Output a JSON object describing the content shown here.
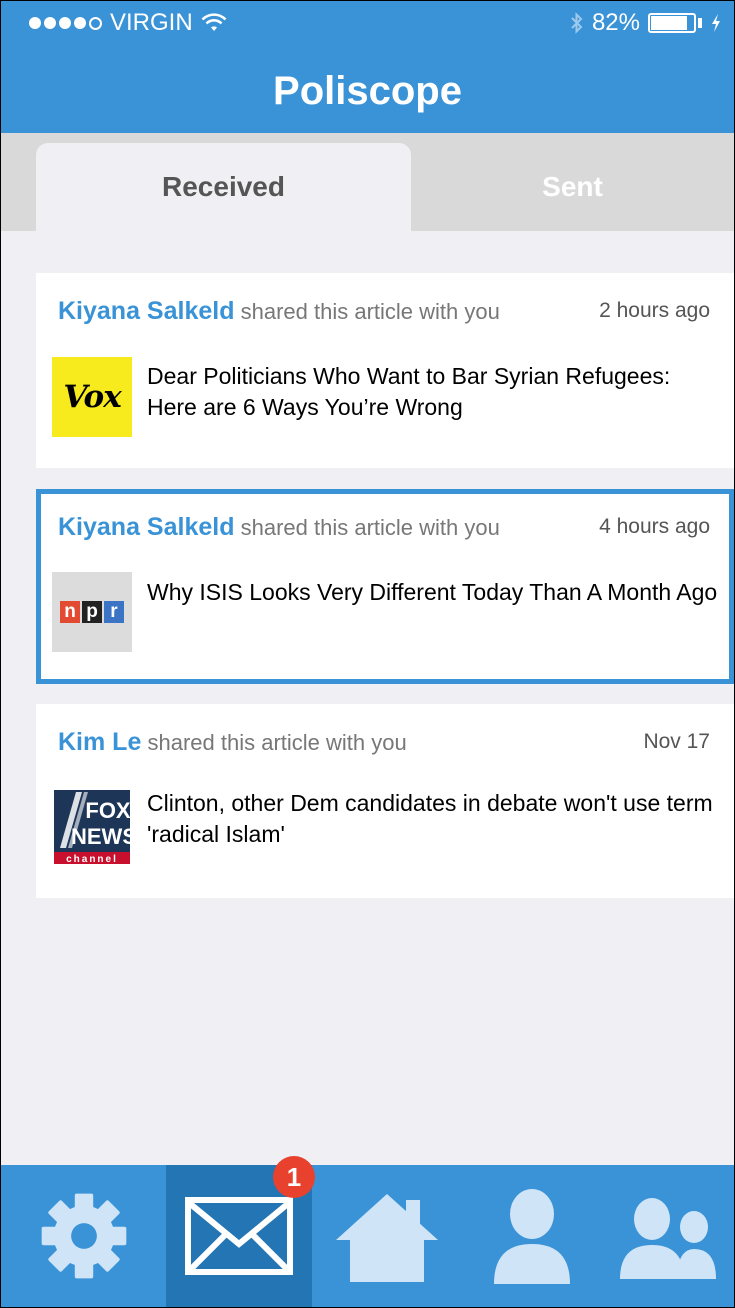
{
  "status_bar": {
    "carrier": "VIRGIN",
    "battery": "82%",
    "signal_dots_filled": 4,
    "signal_dots_total": 5
  },
  "header": {
    "title": "Poliscope"
  },
  "tabs": [
    {
      "label": "Received",
      "active": true
    },
    {
      "label": "Sent",
      "active": false
    }
  ],
  "feed": [
    {
      "sender": "Kiyana Salkeld",
      "action": "shared this article with you",
      "time": "2 hours ago",
      "source": "Vox",
      "logo_text": "Vox",
      "headline": "Dear Politicians Who Want to Bar Syrian Refugees: Here are 6 Ways You’re Wrong",
      "selected": false
    },
    {
      "sender": "Kiyana Salkeld",
      "action": "shared this article with you",
      "time": "4 hours ago",
      "source": "NPR",
      "logo_letters": [
        "n",
        "p",
        "r"
      ],
      "headline": "Why ISIS Looks Very Different Today Than A Month Ago",
      "selected": true
    },
    {
      "sender": "Kim Le",
      "action": "shared this article with you",
      "time": "Nov 17",
      "source": "Fox News",
      "logo_text": [
        "FOX",
        "NEWS",
        "channel"
      ],
      "headline": "Clinton, other Dem candidates in debate won't use term 'radical Islam'",
      "selected": false
    }
  ],
  "bottom_nav": {
    "items": [
      {
        "name": "settings",
        "icon": "gear-icon"
      },
      {
        "name": "messages",
        "icon": "envelope-icon",
        "active": true,
        "badge": "1"
      },
      {
        "name": "home",
        "icon": "home-icon"
      },
      {
        "name": "profile",
        "icon": "person-icon"
      },
      {
        "name": "friends",
        "icon": "people-icon"
      }
    ]
  },
  "colors": {
    "primary": "#3a93d6",
    "primary_dark": "#2475b4",
    "badge": "#e8412d",
    "vox_yellow": "#f7ea1d"
  }
}
